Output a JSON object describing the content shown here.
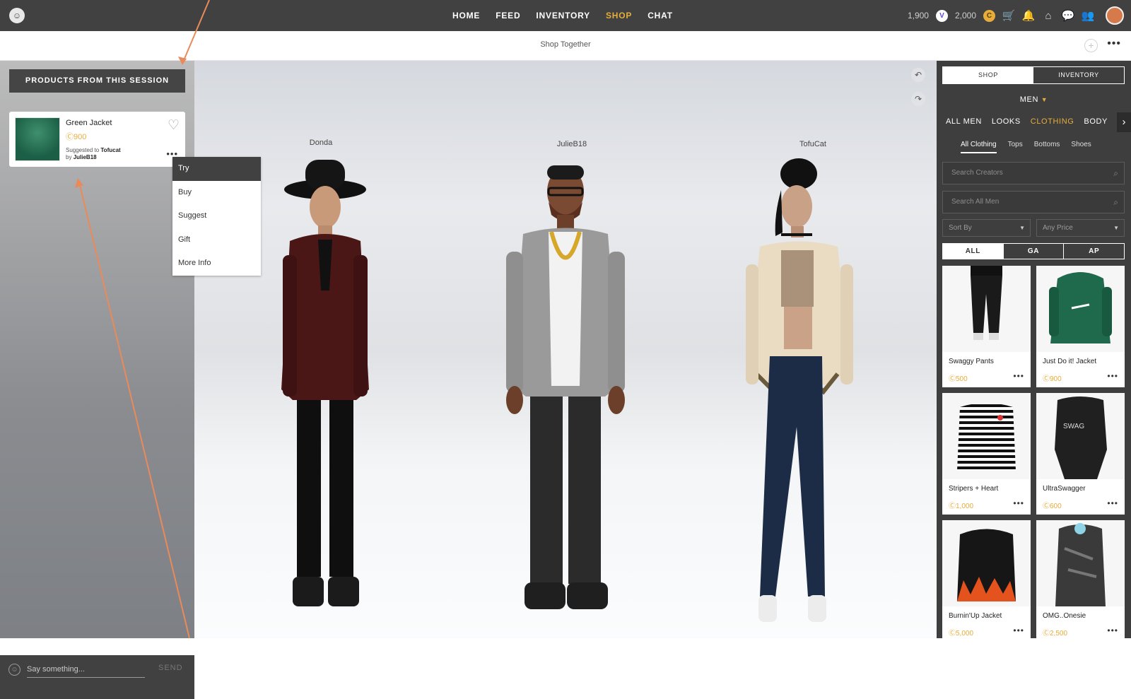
{
  "topbar": {
    "logo": "☺",
    "nav": [
      "HOME",
      "FEED",
      "INVENTORY",
      "SHOP",
      "CHAT"
    ],
    "active_nav": "SHOP",
    "vip_credits": "1,900",
    "credits": "2,000"
  },
  "subbar": {
    "title": "Shop Together"
  },
  "left_panel": {
    "session_button": "PRODUCTS FROM THIS SESSION",
    "product": {
      "name": "Green Jacket",
      "price": "900",
      "suggested_prefix": "Suggested to",
      "suggested_to": "Tofucat",
      "by_prefix": "by",
      "by": "JulieB18"
    },
    "menu": [
      "Try",
      "Buy",
      "Suggest",
      "Gift",
      "More Info"
    ],
    "chat_placeholder": "Say something...",
    "send_label": "SEND"
  },
  "stage": {
    "avatars": [
      "Donda",
      "JulieB18",
      "TofuCat"
    ]
  },
  "right_panel": {
    "tabs": [
      "SHOP",
      "INVENTORY"
    ],
    "gender": "MEN",
    "categories": [
      "ALL MEN",
      "LOOKS",
      "CLOTHING",
      "BODY"
    ],
    "active_category": "CLOTHING",
    "subcategories": [
      "All Clothing",
      "Tops",
      "Bottoms",
      "Shoes"
    ],
    "search_creators_placeholder": "Search Creators",
    "search_all_placeholder": "Search All Men",
    "sort_label": "Sort By",
    "price_label": "Any Price",
    "filters": [
      "ALL",
      "GA",
      "AP"
    ],
    "products": [
      {
        "name": "Swaggy Pants",
        "price": "500"
      },
      {
        "name": "Just Do it! Jacket",
        "price": "900"
      },
      {
        "name": "Stripers + Heart",
        "price": "1,000"
      },
      {
        "name": "UltraSwagger",
        "price": "600"
      },
      {
        "name": "Burnin'Up Jacket",
        "price": "5,000"
      },
      {
        "name": "OMG..Onesie",
        "price": "2,500"
      }
    ]
  },
  "colors": {
    "accent": "#e6ad3b",
    "dark": "#414141",
    "annotation": "#ea8a5b"
  }
}
